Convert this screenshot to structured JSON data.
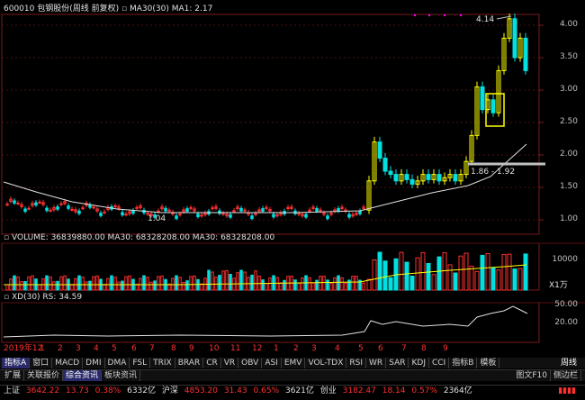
{
  "header": {
    "stock_code": "600010",
    "stock_name": "包钢股份",
    "period_info": "(周线 前复权)",
    "ma_label": "MA30(30)",
    "ma1_text": "MA1: 2.17"
  },
  "price_panel": {
    "y_ticks": [
      "4.00",
      "3.50",
      "3.00",
      "2.50",
      "2.00",
      "1.50",
      "1.00"
    ],
    "high_label": "4.14",
    "low_label": "1.04",
    "box_label": "1.86 - 1.92"
  },
  "volume_panel": {
    "text": "VOLUME: 36839880.00  MA30: 68328208.00  MA30: 68328208.00",
    "y_tick": "10000",
    "unit": "X1万"
  },
  "xd_panel": {
    "text": "XD(30)  RS: 34.59",
    "y_ticks": [
      "50.00",
      "20.00"
    ]
  },
  "time_axis": {
    "labels": [
      "2019年12",
      "1",
      "2",
      "3",
      "4",
      "5",
      "6",
      "7",
      "8",
      "9",
      "10",
      "11",
      "12",
      "1",
      "2",
      "3",
      "4",
      "5",
      "6",
      "7",
      "8",
      "9"
    ]
  },
  "indicator_tabs": {
    "items": [
      "指标A",
      "窗口",
      "MACD",
      "DMI",
      "DMA",
      "FSL",
      "TRIX",
      "BRAR",
      "CR",
      "VR",
      "OBV",
      "ASI",
      "EMV",
      "VOL-TDX",
      "RSI",
      "WR",
      "SAR",
      "KDJ",
      "CCI",
      "指标B",
      "模板"
    ],
    "period_label": "周线"
  },
  "bottom_tabs": {
    "items": [
      "扩展",
      "关联报价",
      "综合资讯",
      "板块资讯"
    ],
    "right_items": [
      "图文F10",
      "侧边栏"
    ]
  },
  "status_bar": {
    "sh_label": "上证",
    "sh_value": "3642.22",
    "sh_change": "13.73",
    "sh_pct": "0.38%",
    "sh_amount": "6332亿",
    "hs_label": "沪深",
    "hs_value": "4853.20",
    "hs_change": "31.43",
    "hs_pct": "0.65%",
    "hs_amount": "3621亿",
    "cy_label": "创业",
    "cy_value": "3182.47",
    "cy_change": "18.14",
    "cy_pct": "0.57%",
    "cy_amount": "2364亿"
  },
  "colors": {
    "up": "#ff3030",
    "down": "#00e0e0",
    "ma_line": "#e0e0e0",
    "yellow": "#ffff00",
    "grid_red": "#7a1a1a",
    "tab_bg": "#101010"
  }
}
